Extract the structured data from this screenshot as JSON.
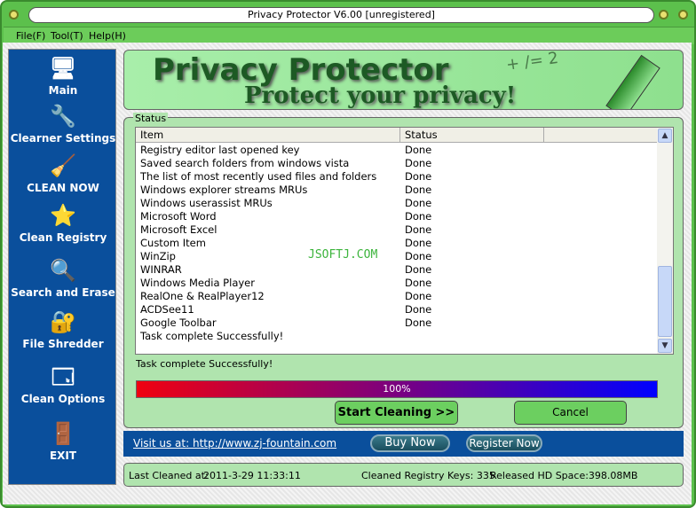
{
  "window": {
    "title": "Privacy Protector V6.00 [unregistered]"
  },
  "menu": [
    "File(F)",
    "Tool(T)",
    "Help(H)"
  ],
  "sidebar": {
    "items": [
      {
        "label": "Main",
        "icon": "computer-icon"
      },
      {
        "label": "Clearner Settings",
        "icon": "wrench-settings-icon"
      },
      {
        "label": "CLEAN NOW",
        "icon": "broom-icon"
      },
      {
        "label": "Clean Registry",
        "icon": "registry-star-icon"
      },
      {
        "label": "Search and  Erase",
        "icon": "magnifier-icon"
      },
      {
        "label": "File Shredder",
        "icon": "lock-keys-icon"
      },
      {
        "label": "Clean Options",
        "icon": "options-window-icon"
      },
      {
        "label": "EXIT",
        "icon": "exit-door-icon"
      }
    ]
  },
  "banner": {
    "title": "Privacy Protector",
    "subtitle": "Protect your privacy!",
    "doodle": "+ /= 2"
  },
  "status_group": {
    "label": "Status",
    "columns": [
      "Item",
      "Status",
      ""
    ],
    "rows": [
      [
        "Registry editor last opened key",
        "Done"
      ],
      [
        "Saved search folders from windows vista",
        "Done"
      ],
      [
        "The list of most recently used files and folders",
        "Done"
      ],
      [
        "Windows explorer streams MRUs",
        "Done"
      ],
      [
        "Windows userassist MRUs",
        "Done"
      ],
      [
        "Microsoft Word",
        "Done"
      ],
      [
        "Microsoft Excel",
        "Done"
      ],
      [
        "Custom Item",
        "Done"
      ],
      [
        "WinZip",
        "Done"
      ],
      [
        "WINRAR",
        "Done"
      ],
      [
        "Windows Media Player",
        "Done"
      ],
      [
        "RealOne & RealPlayer12",
        "Done"
      ],
      [
        "ACDSee11",
        "Done"
      ],
      [
        "Google Toolbar",
        "Done"
      ],
      [
        "Task complete Successfully!",
        ""
      ]
    ],
    "watermark": "JSOFTJ.COM",
    "message": "Task complete Successfully!",
    "progress_percent": 100,
    "progress_label": "100%",
    "start_button": "Start Cleaning >>",
    "cancel_button": "Cancel"
  },
  "footer": {
    "link": "Visit us at: http://www.zj-fountain.com",
    "buy": "Buy Now",
    "register": "Register Now"
  },
  "statusbar": {
    "last_cleaned_label": "Last Cleaned at:",
    "last_cleaned": "2011-3-29 11:33:11",
    "keys": "Cleaned Registry Keys: 335",
    "space": "Released HD Space:398.08MB"
  },
  "colors": {
    "frame": "#5cc04c",
    "sidebar": "#0a4f9c",
    "panel": "#b0e4ae",
    "progress_start": "#f00010",
    "progress_end": "#0000ff"
  }
}
